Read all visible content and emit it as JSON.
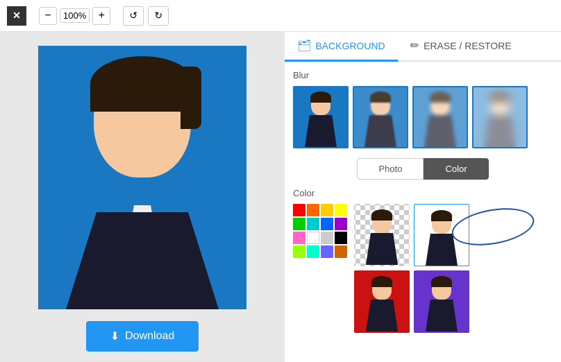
{
  "toolbar": {
    "close_label": "✕",
    "zoom_value": "100%",
    "zoom_minus": "−",
    "zoom_plus": "+",
    "undo_icon": "↺",
    "redo_icon": "↻"
  },
  "tabs": [
    {
      "id": "background",
      "label": "BACKGROUND",
      "icon": "🗂",
      "active": true
    },
    {
      "id": "erase-restore",
      "label": "ERASE / RESTORE",
      "icon": "✏",
      "active": false
    }
  ],
  "background_panel": {
    "blur_section_label": "Blur",
    "toggle": {
      "photo_label": "Photo",
      "color_label": "Color",
      "active": "color"
    },
    "color_section_label": "Color"
  },
  "download_button": {
    "label": "Download",
    "icon": "⬇"
  },
  "color_palette": [
    "#ff0000",
    "#ff6600",
    "#ffcc00",
    "#ffff00",
    "#00cc00",
    "#00cccc",
    "#0066ff",
    "#9900cc",
    "#ff66cc",
    "#ffffff",
    "#cccccc",
    "#000000",
    "#99ff00",
    "#00ffcc",
    "#6666ff",
    "#cc6600"
  ]
}
